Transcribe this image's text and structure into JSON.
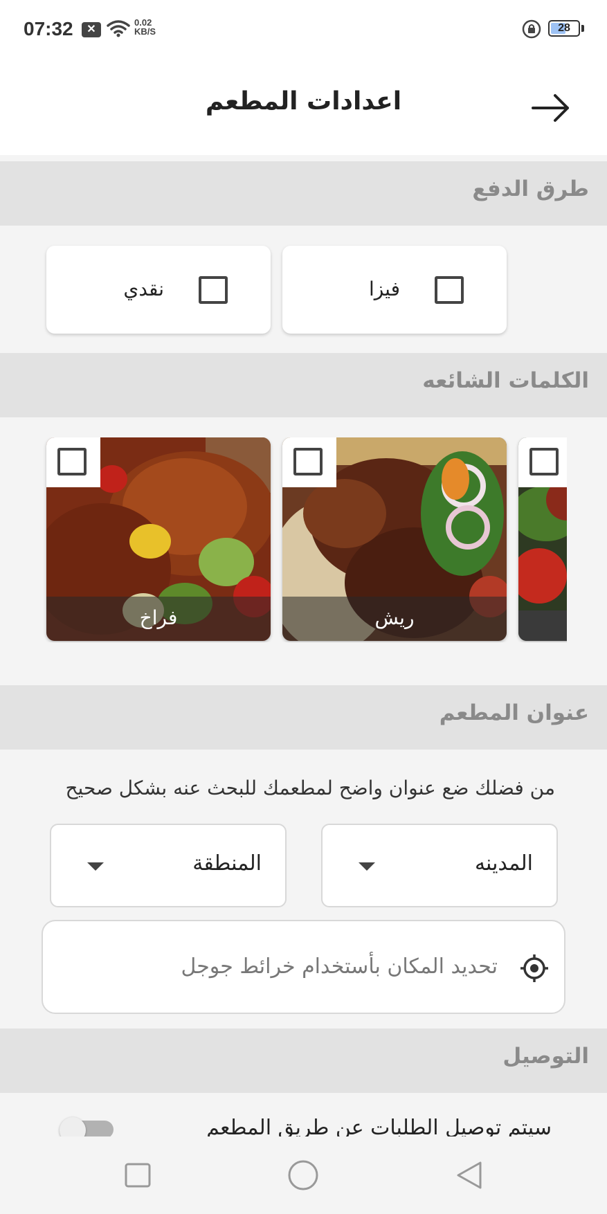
{
  "status_bar": {
    "time": "07:32",
    "notification_icon": "x-box-icon",
    "network_speed_top": "0.02",
    "network_speed_bottom": "KB/S",
    "battery_level": "28",
    "battery_percent": 28
  },
  "header": {
    "title": "اعدادات المطعم",
    "back_icon": "arrow-right-icon"
  },
  "payment": {
    "section_title": "طرق الدفع",
    "options": [
      {
        "label": "فيزا",
        "checked": false
      },
      {
        "label": "نقدي",
        "checked": false
      }
    ]
  },
  "keywords": {
    "section_title": "الكلمات الشائعه",
    "items": [
      {
        "label": "ريش",
        "checked": false
      },
      {
        "label": "فراخ",
        "checked": false
      },
      {
        "label": "",
        "checked": false
      }
    ]
  },
  "address": {
    "section_title": "عنوان المطعم",
    "hint": "من فضلك ضع عنوان واضح لمطعمك للبحث عنه بشكل صحيح",
    "city": {
      "value": "المدينه"
    },
    "area": {
      "value": "المنطقة"
    },
    "map_button_label": "تحديد المكان بأستخدام خرائط جوجل"
  },
  "delivery": {
    "section_title": "التوصيل",
    "description": "سيتم توصيل الطلبات عن طريق المطعم",
    "enabled": false
  },
  "colors": {
    "section_bg": "#e2e2e2",
    "section_text": "#8a8a8a",
    "page_bg": "#f4f4f4"
  }
}
